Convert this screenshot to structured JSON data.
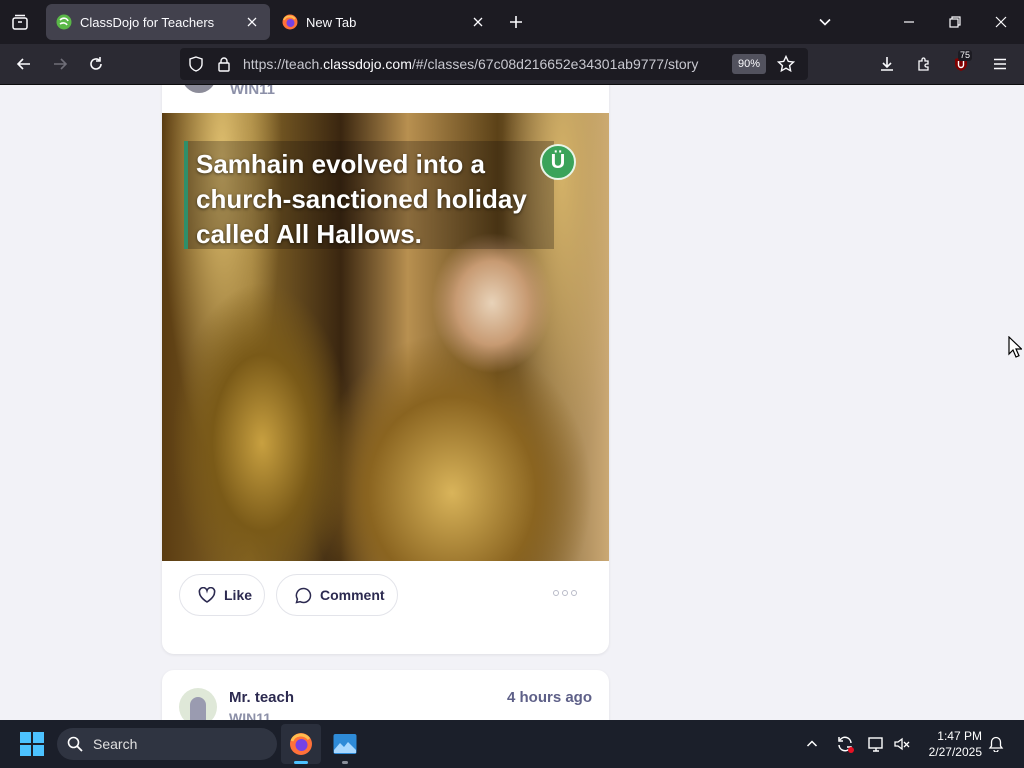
{
  "browser": {
    "tabs": [
      {
        "title": "ClassDojo for Teachers",
        "active": true
      },
      {
        "title": "New Tab",
        "active": false
      }
    ],
    "url_prefix": "https://teach.",
    "url_domain": "classdojo.com",
    "url_path": "/#/classes/67c08d216652e34301ab9777/story",
    "zoom": "90%",
    "extension_badge": "75"
  },
  "story": {
    "top_post_class": "WIN11",
    "image_caption": "Samhain evolved into a church-sanctioned holiday called All Hallows.",
    "image_logo": "Ü",
    "like_label": "Like",
    "comment_label": "Comment"
  },
  "next_post": {
    "author": "Mr. teach",
    "class": "WIN11",
    "time": "4 hours ago"
  },
  "taskbar": {
    "search_placeholder": "Search",
    "time": "1:47 PM",
    "date": "2/27/2025"
  },
  "colors": {
    "tab_bar": "#1c1b22",
    "nav_bar": "#2b2a33",
    "active_tab": "#42414d",
    "page_bg": "#f2f2f7",
    "text_primary": "#2c2a50",
    "text_secondary": "#8c90a8",
    "classdojo_green": "#3aa35a",
    "windows_accent": "#4cc2ff"
  }
}
